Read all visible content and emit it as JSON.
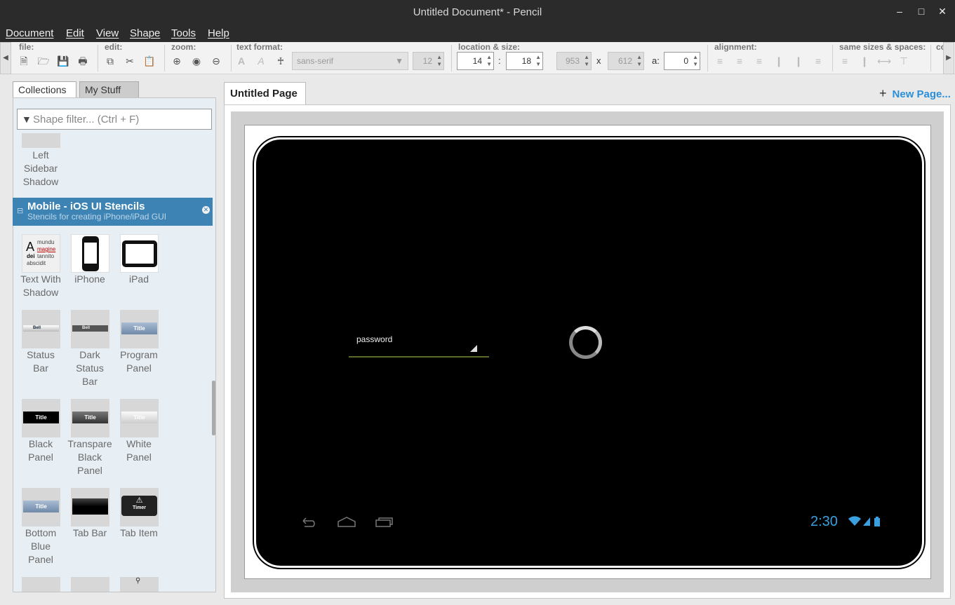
{
  "window": {
    "title": "Untitled Document* - Pencil"
  },
  "menu": [
    "Document",
    "Edit",
    "View",
    "Shape",
    "Tools",
    "Help"
  ],
  "toolbar": {
    "file_label": "file:",
    "edit_label": "edit:",
    "zoom_label": "zoom:",
    "text_format_label": "text format:",
    "font_family": "sans-serif",
    "font_size": "12",
    "location_size_label": "location & size:",
    "x": "14",
    "y": "18",
    "loc_sep": ":",
    "width": "953",
    "height": "612",
    "size_sep": "x",
    "angle_label": "a:",
    "angle": "0",
    "alignment_label": "alignment:",
    "same_sizes_label": "same sizes & spaces:",
    "truncated_label": "co"
  },
  "sidebar": {
    "tabs": [
      "Collections",
      "My Stuff"
    ],
    "filter_placeholder": "Shape filter... (Ctrl + F)",
    "prev_shape": {
      "line1": "Left",
      "line2": "Sidebar",
      "line3": "Shadow"
    },
    "category": {
      "name": "Mobile - iOS UI Stencils",
      "desc": "Stencils for creating iPhone/iPad GUI"
    },
    "shapes": [
      {
        "l1": "Text With",
        "l2": "Shadow",
        "l3": ""
      },
      {
        "l1": "iPhone",
        "l2": "",
        "l3": ""
      },
      {
        "l1": "iPad",
        "l2": "",
        "l3": ""
      },
      {
        "l1": "Status",
        "l2": "Bar",
        "l3": ""
      },
      {
        "l1": "Dark",
        "l2": "Status",
        "l3": "Bar"
      },
      {
        "l1": "Program",
        "l2": "Panel",
        "l3": ""
      },
      {
        "l1": "Black",
        "l2": "Panel",
        "l3": ""
      },
      {
        "l1": "Transpare",
        "l2": "Black",
        "l3": "Panel"
      },
      {
        "l1": "White",
        "l2": "Panel",
        "l3": ""
      },
      {
        "l1": "Bottom",
        "l2": "Blue",
        "l3": "Panel"
      },
      {
        "l1": "Tab Bar",
        "l2": "",
        "l3": ""
      },
      {
        "l1": "Tab Item",
        "l2": "",
        "l3": ""
      }
    ],
    "thumb_text": {
      "text_shadow": [
        "A",
        "mundu",
        "magine",
        "dei",
        "tannito",
        "abscidit"
      ],
      "bell": "Bell",
      "title": "Title",
      "timer": "Timer"
    }
  },
  "canvas": {
    "page_tab": "Untitled Page",
    "new_page": "New Page...",
    "device": {
      "password_label": "password",
      "clock": "2:30"
    }
  }
}
